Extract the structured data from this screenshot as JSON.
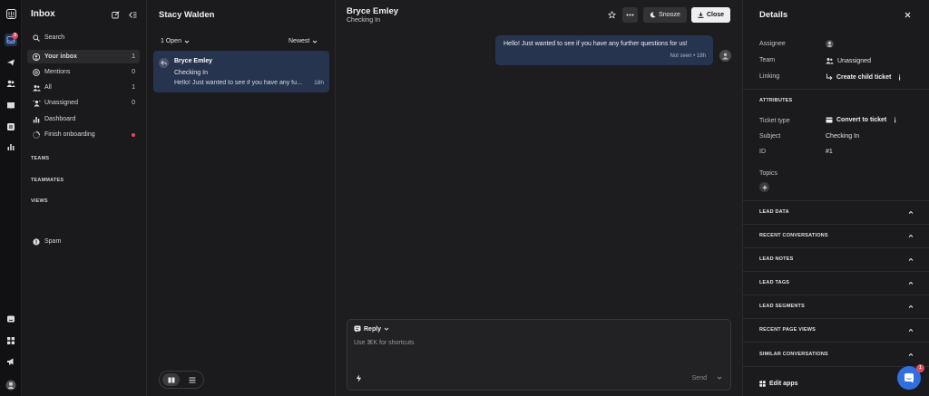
{
  "rail": {
    "inbox_badge": "3",
    "icons": [
      "logo-icon",
      "inbox-icon",
      "outbound-icon",
      "contacts-icon",
      "knowledge-icon",
      "reports-icon",
      "analytics-icon",
      "messenger-icon",
      "apps-icon",
      "announce-icon",
      "profile-icon"
    ]
  },
  "nav": {
    "title": "Inbox",
    "items": [
      {
        "label": "Search",
        "count": ""
      },
      {
        "label": "Your inbox",
        "count": "1"
      },
      {
        "label": "Mentions",
        "count": "0"
      },
      {
        "label": "All",
        "count": "1"
      },
      {
        "label": "Unassigned",
        "count": "0"
      },
      {
        "label": "Dashboard",
        "count": ""
      },
      {
        "label": "Finish onboarding",
        "count": ""
      }
    ],
    "sections": [
      "TEAMS",
      "TEAMMATES",
      "VIEWS"
    ],
    "spam": "Spam"
  },
  "list": {
    "title": "Stacy Walden",
    "filter_open": "1 Open",
    "sort": "Newest",
    "conversation": {
      "name": "Bryce Emley",
      "subject": "Checking In",
      "preview": "Hello! Just wanted to see if you have any fu...",
      "time": "18h"
    }
  },
  "main": {
    "title": "Bryce Emley",
    "subtitle": "Checking In",
    "snooze": "Snooze",
    "close": "Close",
    "message": {
      "text": "Hello! Just wanted to see if you have any further questions for us!",
      "meta": "Not seen • 18h"
    },
    "composer": {
      "mode": "Reply",
      "placeholder": "Use ⌘K for shortcuts",
      "send": "Send"
    }
  },
  "details": {
    "title": "Details",
    "assignee_label": "Assignee",
    "team_label": "Team",
    "team_value": "Unassigned",
    "linking_label": "Linking",
    "linking_value": "Create child ticket",
    "attributes": "ATTRIBUTES",
    "ticket_type_label": "Ticket type",
    "ticket_type_value": "Convert to ticket",
    "subject_label": "Subject",
    "subject_value": "Checking In",
    "id_label": "ID",
    "id_value": "#1",
    "topics_label": "Topics",
    "sections": [
      "LEAD DATA",
      "RECENT CONVERSATIONS",
      "LEAD NOTES",
      "LEAD TAGS",
      "LEAD SEGMENTS",
      "RECENT PAGE VIEWS",
      "SIMILAR CONVERSATIONS"
    ],
    "edit_apps": "Edit apps",
    "messenger_badge": "1"
  },
  "colors": {
    "accent": "#27344f",
    "badge": "#e0485c",
    "fab": "#2f6fe0"
  }
}
